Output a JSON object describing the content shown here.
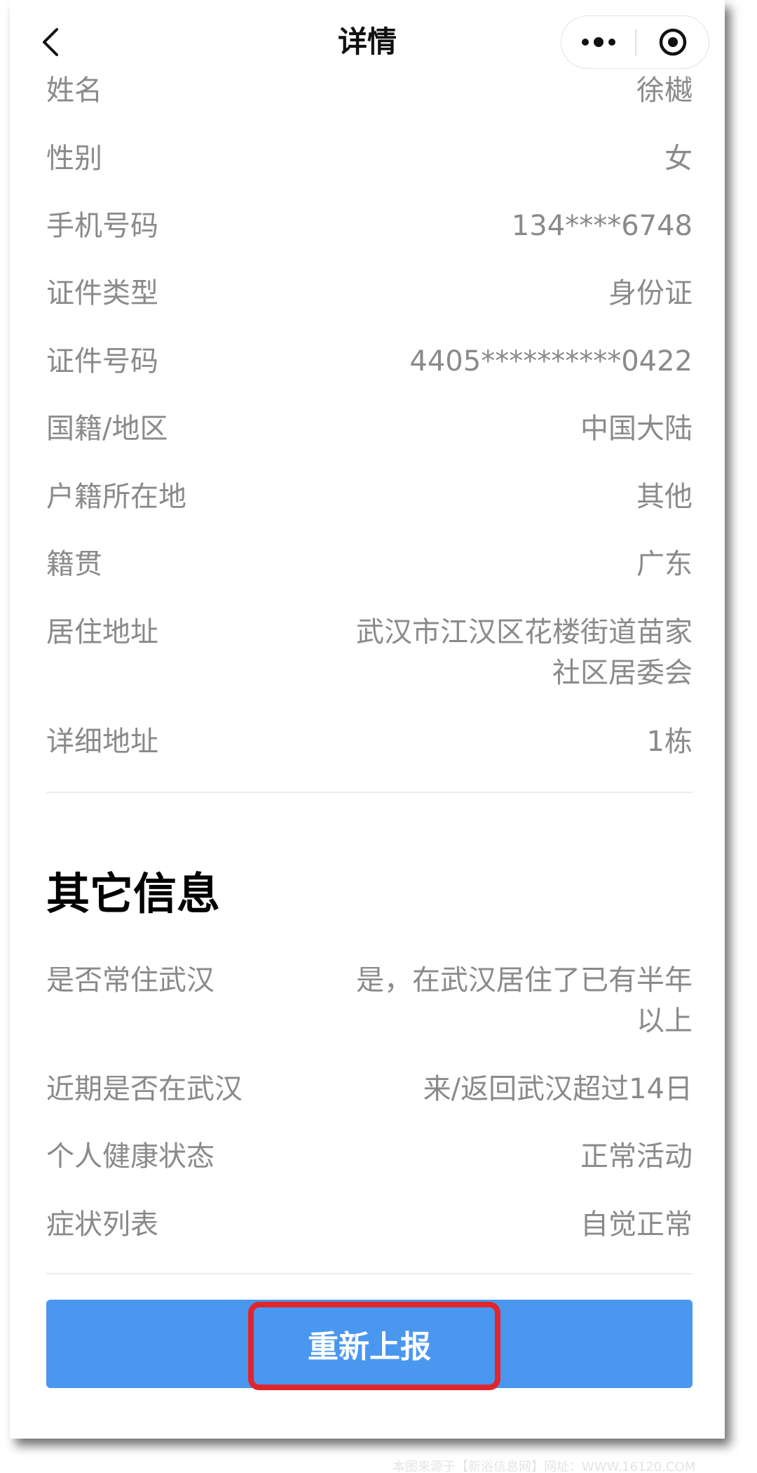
{
  "nav": {
    "title": "详情"
  },
  "personal_rows": [
    {
      "label": "姓名",
      "value": "徐樾"
    },
    {
      "label": "性别",
      "value": "女"
    },
    {
      "label": "手机号码",
      "value": "134****6748"
    },
    {
      "label": "证件类型",
      "value": "身份证"
    },
    {
      "label": "证件号码",
      "value": "4405**********0422"
    },
    {
      "label": "国籍/地区",
      "value": "中国大陆"
    },
    {
      "label": "户籍所在地",
      "value": "其他"
    },
    {
      "label": "籍贯",
      "value": "广东"
    },
    {
      "label": "居住地址",
      "value_line1": "武汉市江汉区花楼街道苗家",
      "value_line2": "社区居委会"
    },
    {
      "label": "详细地址",
      "value": "1栋"
    }
  ],
  "other_section": {
    "title": "其它信息",
    "rows": [
      {
        "label": "是否常住武汉",
        "value_line1": "是，在武汉居住了已有半年",
        "value_line2": "以上"
      },
      {
        "label": "近期是否在武汉",
        "value": "来/返回武汉超过14日"
      },
      {
        "label": "个人健康状态",
        "value": "正常活动"
      },
      {
        "label": "症状列表",
        "value": "自觉正常"
      }
    ]
  },
  "actions": {
    "resubmit_label": "重新上报"
  },
  "watermark": "本图来源于【新浴信息网】网址：WWW.16120.COM",
  "colors": {
    "primary_button": "#4a97f0",
    "highlight_border": "#e0262a",
    "label_text": "#8a8a8a"
  }
}
